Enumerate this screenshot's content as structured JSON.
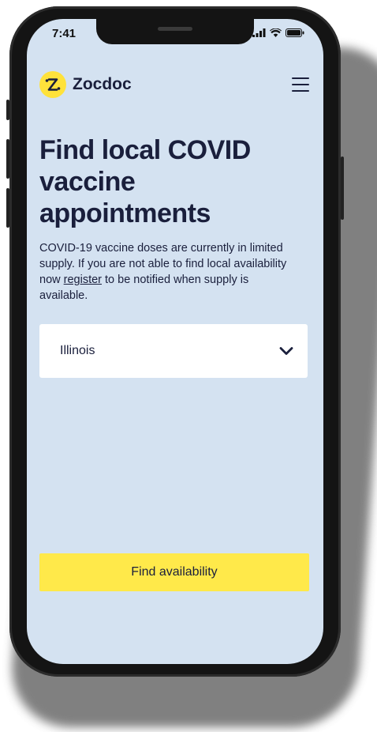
{
  "status_bar": {
    "time": "7:41",
    "icons": [
      "signal-icon",
      "wifi-icon",
      "battery-icon"
    ]
  },
  "header": {
    "brand": "Zocdoc",
    "logo_icon": "zocdoc-logo-icon",
    "menu_icon": "hamburger-menu-icon"
  },
  "main": {
    "headline": "Find local COVID vaccine appointments",
    "description_before_link": "COVID-19 vaccine doses are currently in limited supply. If you are not able to find local availability now ",
    "description_link": "register",
    "description_after_link": " to be notified when supply is available.",
    "state_select": {
      "selected": "Illinois",
      "icon": "chevron-down-icon"
    },
    "cta_label": "Find availability"
  },
  "colors": {
    "screen_background": "#d4e2f1",
    "brand_yellow": "#ffe94a",
    "text_navy": "#1a1f3c"
  }
}
